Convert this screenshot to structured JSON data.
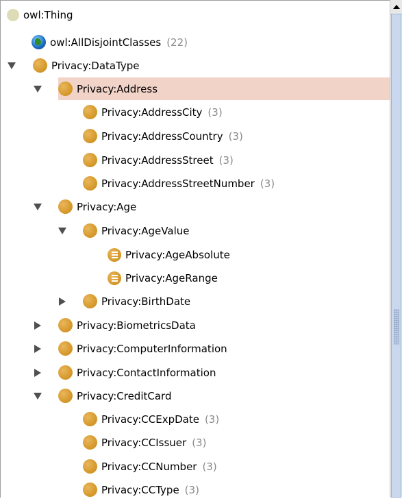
{
  "tree": {
    "rows": [
      {
        "label": "owl:Thing",
        "count": "",
        "icon": "thing-icon",
        "toggle": "none"
      },
      {
        "label": "owl:AllDisjointClasses",
        "count": "(22)",
        "icon": "globe-icon",
        "toggle": "none"
      },
      {
        "label": "Privacy:DataType",
        "count": "",
        "icon": "class-icon",
        "toggle": "expanded"
      },
      {
        "label": "Privacy:Address",
        "count": "",
        "icon": "class-icon",
        "toggle": "expanded",
        "selected": true
      },
      {
        "label": "Privacy:AddressCity",
        "count": "(3)",
        "icon": "class-icon",
        "toggle": "none"
      },
      {
        "label": "Privacy:AddressCountry",
        "count": "(3)",
        "icon": "class-icon",
        "toggle": "none"
      },
      {
        "label": "Privacy:AddressStreet",
        "count": "(3)",
        "icon": "class-icon",
        "toggle": "none"
      },
      {
        "label": "Privacy:AddressStreetNumber",
        "count": "(3)",
        "icon": "class-icon",
        "toggle": "none"
      },
      {
        "label": "Privacy:Age",
        "count": "",
        "icon": "class-icon",
        "toggle": "expanded"
      },
      {
        "label": "Privacy:AgeValue",
        "count": "",
        "icon": "class-icon",
        "toggle": "expanded"
      },
      {
        "label": "Privacy:AgeAbsolute",
        "count": "",
        "icon": "equivalent-class-icon",
        "toggle": "none"
      },
      {
        "label": "Privacy:AgeRange",
        "count": "",
        "icon": "equivalent-class-icon",
        "toggle": "none"
      },
      {
        "label": "Privacy:BirthDate",
        "count": "",
        "icon": "class-icon",
        "toggle": "collapsed"
      },
      {
        "label": "Privacy:BiometricsData",
        "count": "",
        "icon": "class-icon",
        "toggle": "collapsed"
      },
      {
        "label": "Privacy:ComputerInformation",
        "count": "",
        "icon": "class-icon",
        "toggle": "collapsed"
      },
      {
        "label": "Privacy:ContactInformation",
        "count": "",
        "icon": "class-icon",
        "toggle": "collapsed"
      },
      {
        "label": "Privacy:CreditCard",
        "count": "",
        "icon": "class-icon",
        "toggle": "expanded"
      },
      {
        "label": "Privacy:CCExpDate",
        "count": "(3)",
        "icon": "class-icon",
        "toggle": "none"
      },
      {
        "label": "Privacy:CCIssuer",
        "count": "(3)",
        "icon": "class-icon",
        "toggle": "none"
      },
      {
        "label": "Privacy:CCNumber",
        "count": "(3)",
        "icon": "class-icon",
        "toggle": "none"
      },
      {
        "label": "Privacy:CCType",
        "count": "(3)",
        "icon": "class-icon",
        "toggle": "none"
      }
    ]
  },
  "colors": {
    "selection": "#f2d3c8",
    "class_icon": "#d69a2d",
    "count_text": "#8a8a8a",
    "scroll_thumb": "#c9d8ee"
  }
}
